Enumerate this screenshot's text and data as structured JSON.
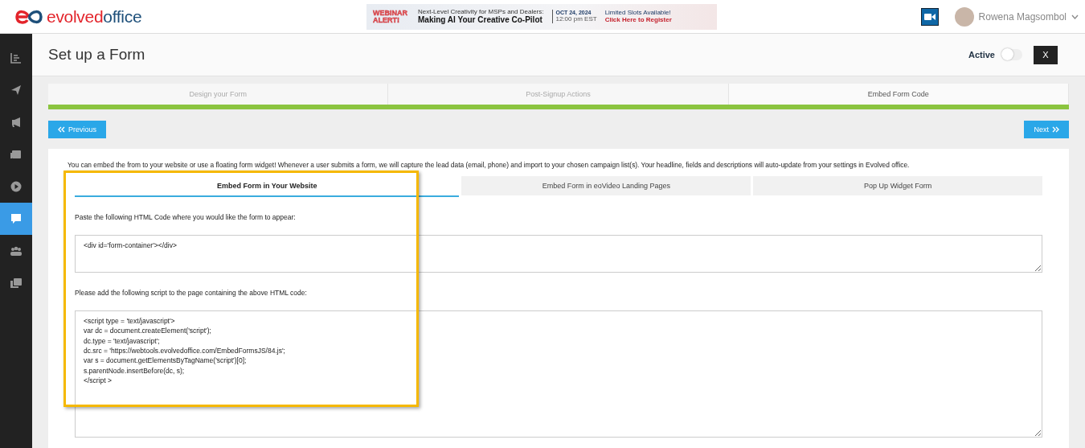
{
  "header": {
    "logo": {
      "part1": "evolved",
      "part2": "office"
    },
    "banner": {
      "badge": "WEBINAR ALERT!",
      "kicker": "Next-Level Creativity for MSPs and Dealers:",
      "headline": "Making AI Your Creative Co-Pilot",
      "date": "OCT 24, 2024",
      "time": "12:00 pm EST",
      "slots": "Limited Slots Available!",
      "cta": "Click Here to Register"
    },
    "user": {
      "name": "Rowena Magsombol"
    }
  },
  "sidebar": {
    "items": [
      {
        "selected": false
      },
      {
        "selected": false
      },
      {
        "selected": false
      },
      {
        "selected": false
      },
      {
        "selected": false
      },
      {
        "selected": true
      },
      {
        "selected": false
      },
      {
        "selected": false
      }
    ]
  },
  "page": {
    "title": "Set up a Form",
    "active_label": "Active",
    "active": false,
    "close": "X"
  },
  "steps": [
    {
      "label": "Design your Form",
      "selected": false
    },
    {
      "label": "Post-Signup Actions",
      "selected": false
    },
    {
      "label": "Embed Form Code",
      "selected": true
    }
  ],
  "progress": {
    "level": 1
  },
  "nav": {
    "previous": "Previous",
    "next": "Next"
  },
  "intro": "You can embed the from to your website or use a floating form widget! Whenever a user submits a form, we will capture the lead data (email, phone) and import to your chosen campaign list(s). Your headline, fields and descriptions will auto-update from your settings in Evolved office.",
  "tabs": [
    {
      "label": "Embed Form in Your Website",
      "selected": true
    },
    {
      "label": "Embed Form in eoVideo Landing Pages",
      "selected": false
    },
    {
      "label": "Pop Up Widget Form",
      "selected": false
    }
  ],
  "html_hint": "Paste the following HTML Code where you would like the form to appear:",
  "html_code": "<div id='form-container'></div>",
  "script_hint": "Please add the following script to the page containing the above HTML code:",
  "script_code": "<script type = 'text/javascript'>\nvar dc = document.createElement('script');\ndc.type = 'text/javascript';\ndc.src = 'https://webtools.evolvedoffice.com/EmbedFormsJS/84.js';\nvar s = document.getElementsByTagName('script')[0];\ns.parentNode.insertBefore(dc, s);\n</script >"
}
